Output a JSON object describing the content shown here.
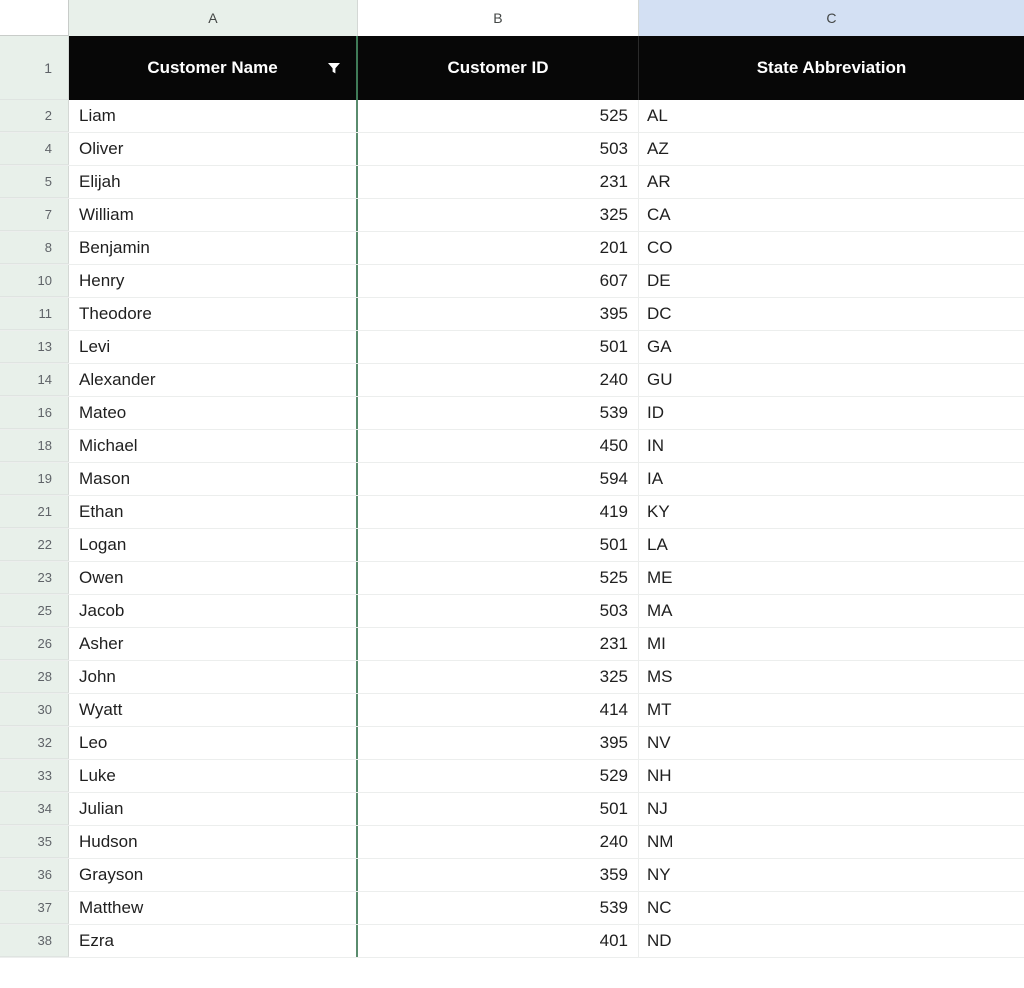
{
  "app": {
    "type": "spreadsheet"
  },
  "grid": {
    "corner_label": "",
    "columns": [
      {
        "letter": "A",
        "selected": false
      },
      {
        "letter": "B",
        "selected": false
      },
      {
        "letter": "C",
        "selected": true
      }
    ],
    "header_row_number": "1",
    "headers": [
      {
        "label": "Customer Name",
        "has_filter_icon": true,
        "filter_icon": "filter-funnel-icon"
      },
      {
        "label": "Customer ID",
        "has_filter_icon": false
      },
      {
        "label": "State Abbreviation",
        "has_filter_icon": false
      }
    ],
    "rows": [
      {
        "n": "2",
        "name": "Liam",
        "id": "525",
        "state": "AL"
      },
      {
        "n": "4",
        "name": "Oliver",
        "id": "503",
        "state": "AZ"
      },
      {
        "n": "5",
        "name": "Elijah",
        "id": "231",
        "state": "AR"
      },
      {
        "n": "7",
        "name": "William",
        "id": "325",
        "state": "CA"
      },
      {
        "n": "8",
        "name": "Benjamin",
        "id": "201",
        "state": "CO"
      },
      {
        "n": "10",
        "name": "Henry",
        "id": "607",
        "state": "DE"
      },
      {
        "n": "11",
        "name": "Theodore",
        "id": "395",
        "state": "DC"
      },
      {
        "n": "13",
        "name": "Levi",
        "id": "501",
        "state": "GA"
      },
      {
        "n": "14",
        "name": "Alexander",
        "id": "240",
        "state": "GU"
      },
      {
        "n": "16",
        "name": "Mateo",
        "id": "539",
        "state": "ID"
      },
      {
        "n": "18",
        "name": "Michael",
        "id": "450",
        "state": "IN"
      },
      {
        "n": "19",
        "name": "Mason",
        "id": "594",
        "state": "IA"
      },
      {
        "n": "21",
        "name": "Ethan",
        "id": "419",
        "state": "KY"
      },
      {
        "n": "22",
        "name": "Logan",
        "id": "501",
        "state": "LA"
      },
      {
        "n": "23",
        "name": "Owen",
        "id": "525",
        "state": "ME"
      },
      {
        "n": "25",
        "name": "Jacob",
        "id": "503",
        "state": "MA"
      },
      {
        "n": "26",
        "name": "Asher",
        "id": "231",
        "state": "MI"
      },
      {
        "n": "28",
        "name": "John",
        "id": "325",
        "state": "MS"
      },
      {
        "n": "30",
        "name": "Wyatt",
        "id": "414",
        "state": "MT"
      },
      {
        "n": "32",
        "name": "Leo",
        "id": "395",
        "state": "NV"
      },
      {
        "n": "33",
        "name": "Luke",
        "id": "529",
        "state": "NH"
      },
      {
        "n": "34",
        "name": "Julian",
        "id": "501",
        "state": "NJ"
      },
      {
        "n": "35",
        "name": "Hudson",
        "id": "240",
        "state": "NM"
      },
      {
        "n": "36",
        "name": "Grayson",
        "id": "359",
        "state": "NY"
      },
      {
        "n": "37",
        "name": "Matthew",
        "id": "539",
        "state": "NC"
      },
      {
        "n": "38",
        "name": "Ezra",
        "id": "401",
        "state": "ND"
      }
    ]
  },
  "colors": {
    "header_band": "#070707",
    "header_text": "#ffffff",
    "col_header_default": "#e8f0ea",
    "col_header_selected": "#d3e0f3",
    "column_divider_accent": "#5a8c6e",
    "row_header_bg": "#e8f0ea",
    "cell_text": "#1f1f1f"
  }
}
